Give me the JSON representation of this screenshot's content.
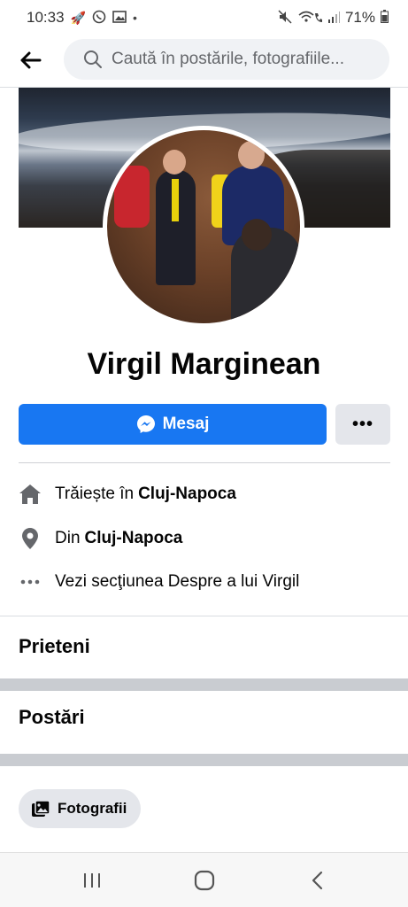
{
  "status_bar": {
    "time": "10:33",
    "battery": "71%",
    "notification_icons": [
      "rocket-icon",
      "whatsapp-icon",
      "image-icon",
      "dot-icon"
    ],
    "system_icons": [
      "mute-icon",
      "wifi-call-icon",
      "signal-icon",
      "battery-icon"
    ]
  },
  "search": {
    "placeholder": "Caută în postările, fotografiile..."
  },
  "profile": {
    "name": "Virgil Marginean"
  },
  "actions": {
    "message_label": "Mesaj",
    "more_label": "•••"
  },
  "intro": {
    "lives_prefix": "Trăiește în",
    "lives_city": "Cluj-Napoca",
    "from_prefix": "Din",
    "from_city": "Cluj-Napoca",
    "about_label": "Vezi secţiunea Despre a lui Virgil"
  },
  "sections": {
    "friends": "Prieteni",
    "posts": "Postări"
  },
  "filters": {
    "photos_label": "Fotografii"
  },
  "colors": {
    "accent": "#1877f2",
    "secondary_button": "#e4e6eb",
    "search_bg": "#f0f2f5",
    "section_gap": "#c9ccd1"
  }
}
